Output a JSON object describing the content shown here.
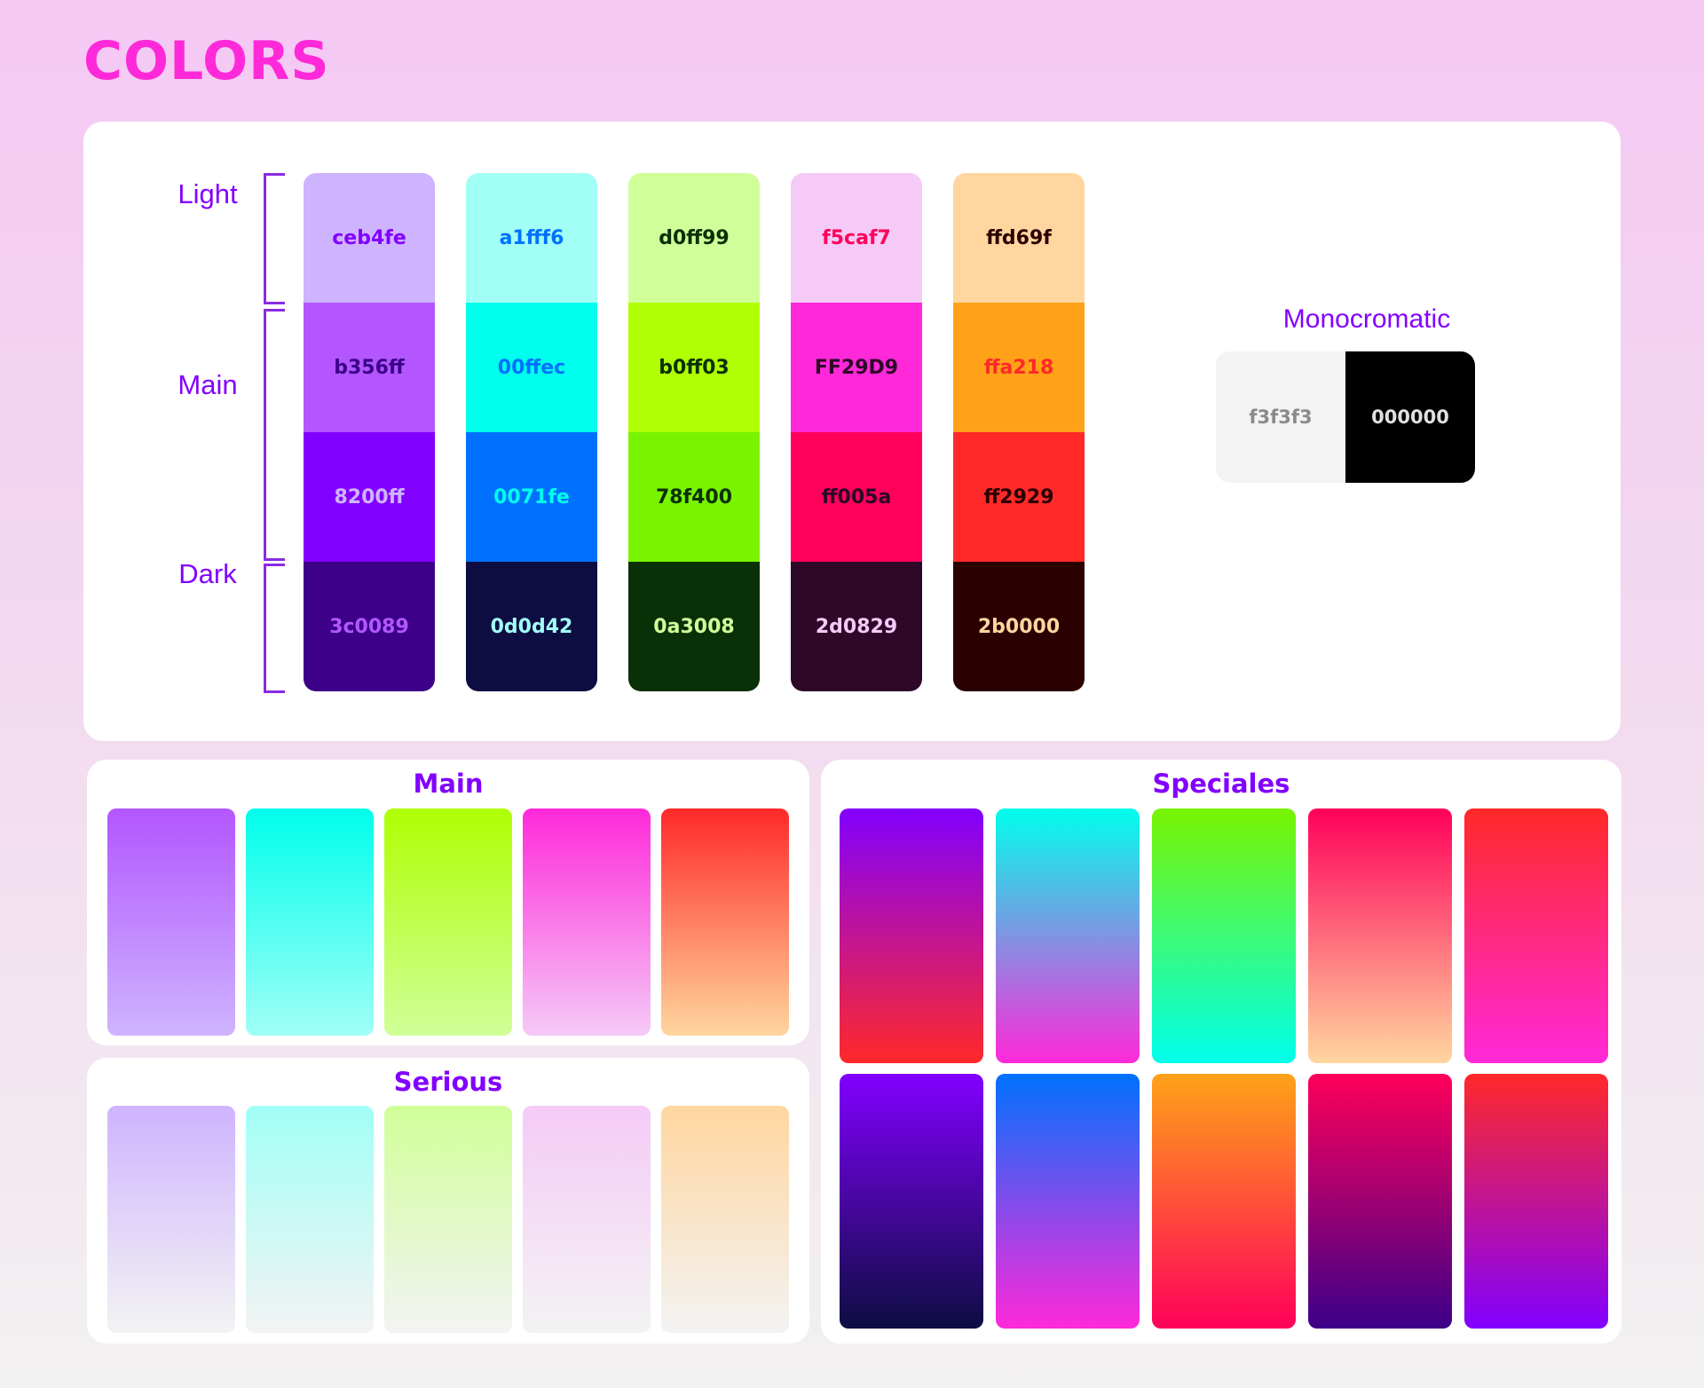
{
  "title": "COLORS",
  "row_labels": {
    "light": "Light",
    "main": "Main",
    "dark": "Dark"
  },
  "palette": [
    {
      "light": {
        "hex": "ceb4fe",
        "bg": "#ceb4fe",
        "fg": "#8200ff"
      },
      "main": {
        "hex": "b356ff",
        "bg": "#b356ff",
        "fg": "#3c0089"
      },
      "mid": {
        "hex": "8200ff",
        "bg": "#8200ff",
        "fg": "#ceb4fe"
      },
      "dark": {
        "hex": "3c0089",
        "bg": "#3c0089",
        "fg": "#b356ff"
      }
    },
    {
      "light": {
        "hex": "a1fff6",
        "bg": "#a1fff6",
        "fg": "#0071fe"
      },
      "main": {
        "hex": "00ffec",
        "bg": "#00ffec",
        "fg": "#0071fe"
      },
      "mid": {
        "hex": "0071fe",
        "bg": "#0071fe",
        "fg": "#00ffec"
      },
      "dark": {
        "hex": "0d0d42",
        "bg": "#0d0d42",
        "fg": "#a1fff6"
      }
    },
    {
      "light": {
        "hex": "d0ff99",
        "bg": "#d0ff99",
        "fg": "#0a3008"
      },
      "main": {
        "hex": "b0ff03",
        "bg": "#b0ff03",
        "fg": "#0a3008"
      },
      "mid": {
        "hex": "78f400",
        "bg": "#78f400",
        "fg": "#0a3008"
      },
      "dark": {
        "hex": "0a3008",
        "bg": "#0a3008",
        "fg": "#d0ff99"
      }
    },
    {
      "light": {
        "hex": "f5caf7",
        "bg": "#f5caf7",
        "fg": "#ff005a"
      },
      "main": {
        "hex": "FF29D9",
        "bg": "#ff29d9",
        "fg": "#2d0829"
      },
      "mid": {
        "hex": "ff005a",
        "bg": "#ff005a",
        "fg": "#2d0829"
      },
      "dark": {
        "hex": "2d0829",
        "bg": "#2d0829",
        "fg": "#f5caf7"
      }
    },
    {
      "light": {
        "hex": "ffd69f",
        "bg": "#ffd69f",
        "fg": "#2b0000"
      },
      "main": {
        "hex": "ffa218",
        "bg": "#ffa218",
        "fg": "#ff2929"
      },
      "mid": {
        "hex": "ff2929",
        "bg": "#ff2929",
        "fg": "#2b0000"
      },
      "dark": {
        "hex": "2b0000",
        "bg": "#2b0000",
        "fg": "#ffd69f"
      }
    }
  ],
  "monochromatic": {
    "title": "Monocromatic",
    "light": {
      "hex": "f3f3f3",
      "bg": "#f3f3f3",
      "fg": "#8a8a8a"
    },
    "dark": {
      "hex": "000000",
      "bg": "#000000",
      "fg": "#e0e0e0"
    }
  },
  "main_gradients": {
    "title": "Main",
    "items": [
      {
        "from": "#b356ff",
        "to": "#ceb4fe"
      },
      {
        "from": "#00ffec",
        "to": "#a1fff6"
      },
      {
        "from": "#b0ff03",
        "to": "#d0ff99"
      },
      {
        "from": "#ff29d9",
        "to": "#f5caf7"
      },
      {
        "from": "#ff2929",
        "to": "#ffd69f"
      }
    ]
  },
  "serious_gradients": {
    "title": "Serious",
    "items": [
      {
        "from": "#ceb4fe",
        "to": "#f3f3f3"
      },
      {
        "from": "#a1fff6",
        "to": "#f3f3f3"
      },
      {
        "from": "#d0ff99",
        "to": "#f3f3f3"
      },
      {
        "from": "#f5caf7",
        "to": "#f3f3f3"
      },
      {
        "from": "#ffd69f",
        "to": "#f3f3f3"
      }
    ]
  },
  "special_gradients": {
    "title": "Speciales",
    "rows": [
      [
        {
          "from": "#8200ff",
          "to": "#ff2929"
        },
        {
          "from": "#00ffec",
          "to": "#ff29d9"
        },
        {
          "from": "#78f400",
          "to": "#00ffec"
        },
        {
          "from": "#ff005a",
          "to": "#ffd69f"
        },
        {
          "from": "#ff2929",
          "to": "#ff29d9"
        }
      ],
      [
        {
          "from": "#8200ff",
          "to": "#0d0d42"
        },
        {
          "from": "#0071fe",
          "to": "#ff29d9"
        },
        {
          "from": "#ffa218",
          "to": "#ff005a"
        },
        {
          "from": "#ff005a",
          "to": "#3c0089"
        },
        {
          "from": "#ff2929",
          "to": "#8200ff"
        }
      ]
    ]
  }
}
